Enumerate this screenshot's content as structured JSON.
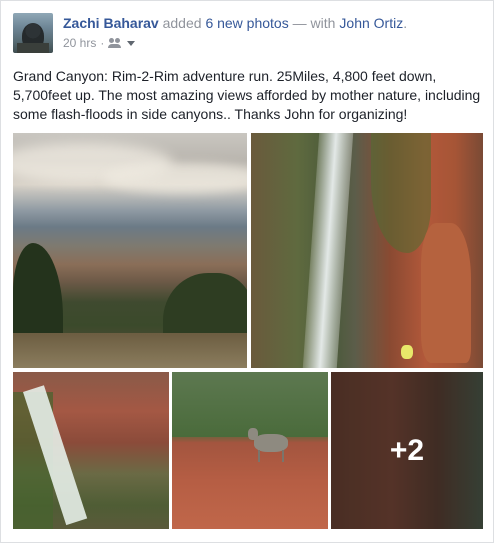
{
  "post": {
    "author": "Zachi Baharav",
    "action": "added",
    "photo_count_label": "6 new photos",
    "with_sep": "— with",
    "tagged": "John Ortiz",
    "period": ".",
    "time": "20 hrs",
    "dot": "·",
    "privacy_icon": "friends-icon",
    "text": "Grand Canyon: Rim-2-Rim adventure run. 25Miles, 4,800 feet down, 5,700feet up. The most amazing views afforded by mother nature, including some flash-floods in side canyons.. Thanks John for organizing!",
    "more_photos_label": "+2"
  },
  "colors": {
    "link": "#365899",
    "muted": "#90949c",
    "text": "#1d2129"
  }
}
